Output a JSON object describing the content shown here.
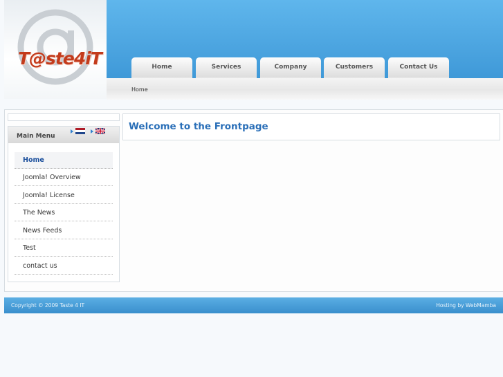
{
  "logo": {
    "text": "T@ste4iT"
  },
  "nav": {
    "tabs": [
      {
        "label": "Home"
      },
      {
        "label": "Services"
      },
      {
        "label": "Company"
      },
      {
        "label": "Customers"
      },
      {
        "label": "Contact Us"
      }
    ]
  },
  "breadcrumb": {
    "text": "Home"
  },
  "sidebar": {
    "title": "Main Menu",
    "languages": [
      {
        "icon": "dutch-flag-icon"
      },
      {
        "icon": "uk-flag-icon"
      }
    ],
    "items": [
      {
        "label": "Home",
        "active": true
      },
      {
        "label": "Joomla! Overview"
      },
      {
        "label": "Joomla! License"
      },
      {
        "label": "The News"
      },
      {
        "label": "News Feeds"
      },
      {
        "label": "Test"
      },
      {
        "label": "contact us"
      }
    ]
  },
  "content": {
    "title": "Welcome to the Frontpage"
  },
  "footer": {
    "copyright": "Copyright © 2009 Taste 4 IT",
    "hosting": "Hosting by WebMamba"
  },
  "colors": {
    "header_blue": "#4aa6e0",
    "title_blue": "#2a6fb8",
    "logo_red": "#c33b1c"
  }
}
